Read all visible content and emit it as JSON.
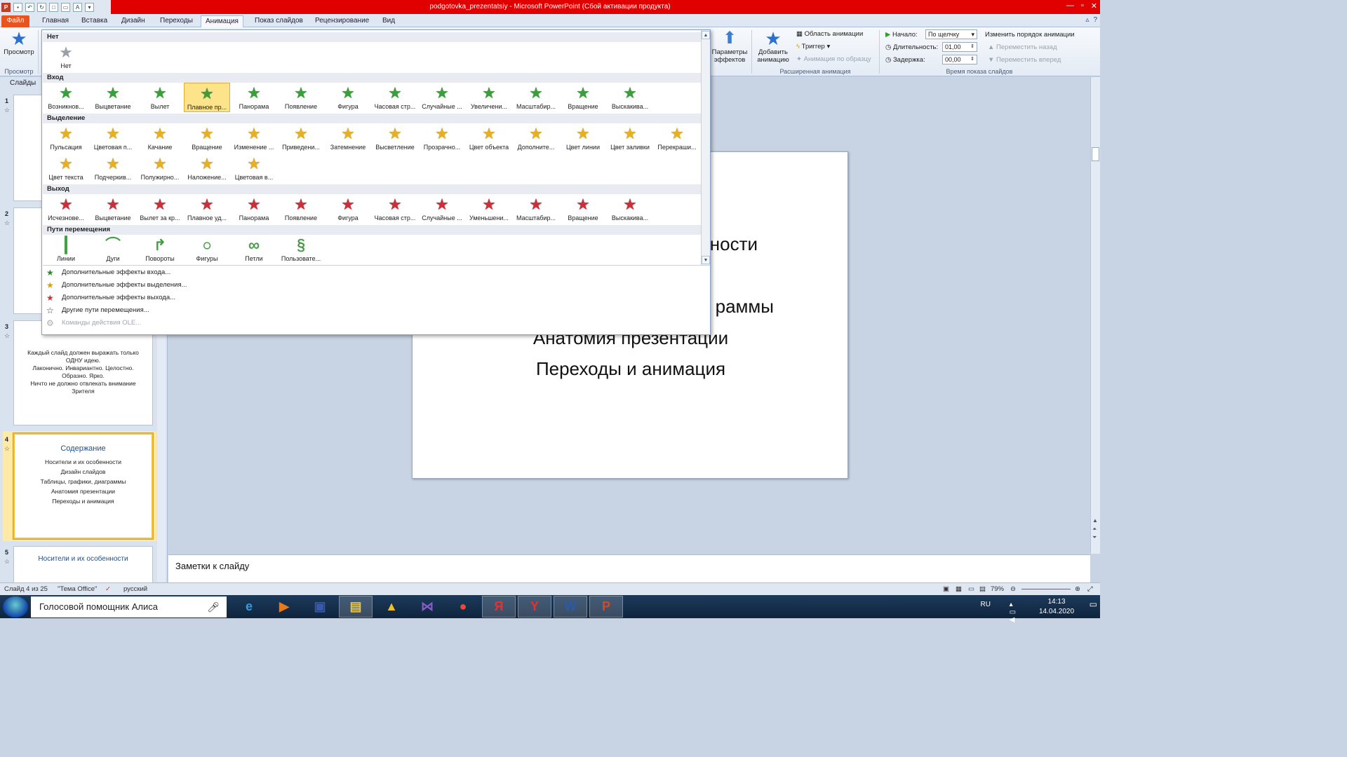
{
  "window": {
    "title": "podgotovka_prezentatsiy - Microsoft PowerPoint (Сбой активации продукта)"
  },
  "qat": {
    "app_icon": "powerpoint-icon",
    "app_letter": "P",
    "font_box": "A"
  },
  "tabs": [
    {
      "label": "Файл",
      "active": false
    },
    {
      "label": "Главная",
      "active": false
    },
    {
      "label": "Вставка",
      "active": false
    },
    {
      "label": "Дизайн",
      "active": false
    },
    {
      "label": "Переходы",
      "active": false
    },
    {
      "label": "Анимация",
      "active": true
    },
    {
      "label": "Показ слайдов",
      "active": false
    },
    {
      "label": "Рецензирование",
      "active": false
    },
    {
      "label": "Вид",
      "active": false
    }
  ],
  "ribbon": {
    "preview_label": "Просмотр",
    "preview_group": "Просмотр",
    "effect_params_l1": "Параметры",
    "effect_params_l2": "эффектов",
    "add_anim_l1": "Добавить",
    "add_anim_l2": "анимацию",
    "anim_area": "Область анимации",
    "trigger": "Триггер",
    "anim_painter": "Анимация по образцу",
    "advanced_group": "Расширенная анимация",
    "start_label": "Начало:",
    "start_value": "По щелчку",
    "duration_label": "Длительность:",
    "duration_value": "01,00",
    "delay_label": "Задержка:",
    "delay_value": "00,00",
    "reorder_title": "Изменить порядок анимации",
    "move_back": "Переместить назад",
    "move_forward": "Переместить вперед",
    "timing_group": "Время показа слайдов"
  },
  "slides_pane": {
    "header": "Слайды",
    "slides": [
      {
        "num": "1"
      },
      {
        "num": "2"
      },
      {
        "num": "3",
        "lines": [
          "Каждый слайд должен выражать только ОДНУ идею.",
          "Лаконично. Инвариантно. Целостно. Образно. Ярко.",
          "Ничто не должно отвлекать внимание Зрителя"
        ]
      },
      {
        "num": "4",
        "title": "Содержание",
        "lines": [
          "Носители и их особенности",
          "Дизайн слайдов",
          "Таблицы, графики, диаграммы",
          "Анатомия презентации",
          "Переходы и анимация"
        ]
      },
      {
        "num": "5",
        "title": "Носители и их особенности"
      }
    ]
  },
  "slide": {
    "line1": "ности",
    "line2": "раммы",
    "line3": "Анатомия презентации",
    "line4": "Переходы и анимация"
  },
  "notes_placeholder": "Заметки к слайду",
  "status": {
    "slide_info": "Слайд 4 из 25",
    "theme": "\"Тема Office\"",
    "language": "русский",
    "zoom": "79%"
  },
  "gallery": {
    "sections": {
      "none": "Нет",
      "entrance": "Вход",
      "emphasis": "Выделение",
      "exit": "Выход",
      "paths": "Пути перемещения"
    },
    "none_items": [
      {
        "label": "Нет",
        "icon": "star-gray-icon"
      }
    ],
    "entrance": [
      "Возникнов...",
      "Выцветание",
      "Вылет",
      "Плавное пр...",
      "Панорама",
      "Появление",
      "Фигура",
      "Часовая стр...",
      "Случайные ...",
      "Увеличени...",
      "Масштабир...",
      "Вращение",
      "Выскакива..."
    ],
    "emphasis_row1": [
      "Пульсация",
      "Цветовая п...",
      "Качание",
      "Вращение",
      "Изменение ...",
      "Приведени...",
      "Затемнение",
      "Высветление",
      "Прозрачно...",
      "Цвет объекта",
      "Дополните...",
      "Цвет линии",
      "Цвет заливки",
      "Перекраши..."
    ],
    "emphasis_row2": [
      "Цвет текста",
      "Подчеркив...",
      "Полужирно...",
      "Наложение...",
      "Цветовая в..."
    ],
    "exit": [
      "Исчезнове...",
      "Выцветание",
      "Вылет за кр...",
      "Плавное уд...",
      "Панорама",
      "Появление",
      "Фигура",
      "Часовая стр...",
      "Случайные ...",
      "Уменьшени...",
      "Масштабир...",
      "Вращение",
      "Выскакива..."
    ],
    "paths": [
      "Линии",
      "Дуги",
      "Повороты",
      "Фигуры",
      "Петли",
      "Пользовате..."
    ],
    "highlighted_entrance": 3
  },
  "gallery_menu": [
    {
      "label": "Дополнительные эффекты входа...",
      "icon": "star-green-icon",
      "disabled": false
    },
    {
      "label": "Дополнительные эффекты выделения...",
      "icon": "star-gold-icon",
      "disabled": false
    },
    {
      "label": "Дополнительные эффекты выхода...",
      "icon": "star-red-icon",
      "disabled": false
    },
    {
      "label": "Другие пути перемещения...",
      "icon": "star-outline-icon",
      "disabled": false
    },
    {
      "label": "Команды действия OLE...",
      "icon": "gear-gray-icon",
      "disabled": true
    }
  ],
  "taskbar": {
    "search_text": "Голосовой помощник Алиса",
    "lang": "RU",
    "time": "14:13",
    "date": "14.04.2020",
    "apps": [
      {
        "name": "ie-icon",
        "glyph": "e"
      },
      {
        "name": "media-player-icon",
        "glyph": "▶"
      },
      {
        "name": "archive-icon",
        "glyph": "▣"
      },
      {
        "name": "file-explorer-icon",
        "glyph": "▤"
      },
      {
        "name": "arch-app-icon",
        "glyph": "▲"
      },
      {
        "name": "visual-studio-icon",
        "glyph": "⋈"
      },
      {
        "name": "chrome-icon",
        "glyph": "●"
      },
      {
        "name": "yandex-icon",
        "glyph": "Я"
      },
      {
        "name": "yandex-browser-icon",
        "glyph": "Y"
      },
      {
        "name": "word-icon",
        "glyph": "W"
      },
      {
        "name": "powerpoint-taskbar-icon",
        "glyph": "P"
      }
    ]
  }
}
